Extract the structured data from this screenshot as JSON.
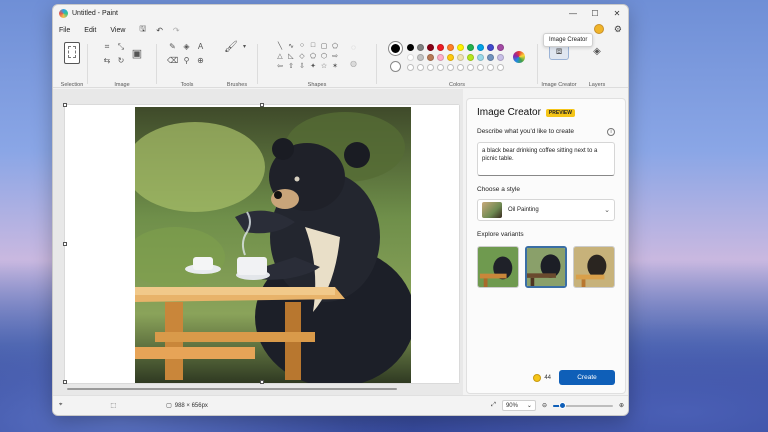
{
  "window": {
    "title": "Untitled - Paint",
    "controls": {
      "minimize": "—",
      "maximize": "☐",
      "close": "✕"
    }
  },
  "menu": {
    "items": [
      "File",
      "Edit",
      "View"
    ],
    "tooltip": "Image Creator"
  },
  "ribbon": {
    "groups": {
      "selection": "Selection",
      "image": "Image",
      "tools": "Tools",
      "brushes": "Brushes",
      "shapes": "Shapes",
      "colors": "Colors",
      "image_creator": "Image Creator",
      "layers": "Layers"
    },
    "palette_row1": [
      "#000000",
      "#7f7f7f",
      "#880015",
      "#ed1c24",
      "#ff7f27",
      "#fff200",
      "#22b14c",
      "#00a2e8",
      "#3f48cc",
      "#a349a4"
    ],
    "palette_row2": [
      "#ffffff",
      "#c3c3c3",
      "#b97a57",
      "#ffaec9",
      "#ffc90e",
      "#efe4b0",
      "#b5e61d",
      "#99d9ea",
      "#7092be",
      "#c8bfe7"
    ],
    "primary_color": "#000000",
    "secondary_color": "#ffffff"
  },
  "panel": {
    "title": "Image Creator",
    "badge": "PREVIEW",
    "prompt_label": "Describe what you'd like to create",
    "prompt_value": "a black bear drinking coffee sitting next to a picnic table.",
    "style_label": "Choose a style",
    "style_value": "Oil Painting",
    "variants_label": "Explore variants",
    "credits": "44",
    "create_label": "Create"
  },
  "status": {
    "dimensions": "988 × 656px",
    "zoom": "90%",
    "zoom_level": 0.15
  },
  "colors": {
    "accent": "#0f5fb8",
    "badge": "#f5c518"
  }
}
